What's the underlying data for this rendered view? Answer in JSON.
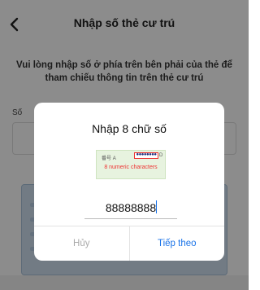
{
  "header": {
    "title": "Nhập số thẻ cư trú",
    "back_icon": "chevron-left-icon"
  },
  "instruction": "Vui lòng nhập số ở phía trên bên phải của thẻ để tham chiếu thông tin trên thẻ cư trú",
  "form": {
    "field_label": "Số"
  },
  "dialog": {
    "title": "Nhập 8 chữ số",
    "hint": {
      "label_prefix": "番号",
      "prefix_letter": "A",
      "masked_digits": "●●●●●●●●",
      "suffix_letter": "D",
      "caption": "8 numeric characters"
    },
    "input_value": "88888888",
    "cancel_label": "Hủy",
    "next_label": "Tiếp theo"
  },
  "colors": {
    "accent": "#1a73e8",
    "hint_red": "#e33333",
    "overlay": "rgba(0,0,0,0.45)"
  }
}
